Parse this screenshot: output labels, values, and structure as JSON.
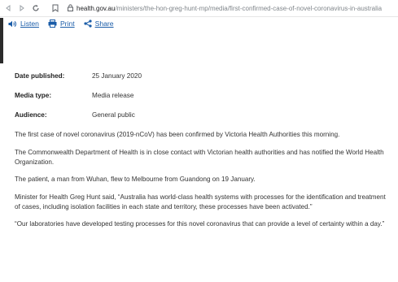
{
  "browser": {
    "url_domain": "health.gov.au",
    "url_path": "/ministers/the-hon-greg-hunt-mp/media/first-confirmed-case-of-novel-coronavirus-in-australia"
  },
  "tools": {
    "listen": "Listen",
    "print": "Print",
    "share": "Share"
  },
  "meta": {
    "date_key": "Date published:",
    "date_value": "25 January 2020",
    "type_key": "Media type:",
    "type_value": "Media release",
    "audience_key": "Audience:",
    "audience_value": "General public"
  },
  "article": {
    "p1": "The first case of novel coronavirus (2019-nCoV) has been confirmed by Victoria Health Authorities this morning.",
    "p2": "The Commonwealth Department of Health is in close contact with Victorian health authorities and has notified the World Health Organization.",
    "p3": "The patient, a man from Wuhan, flew to Melbourne from Guandong on 19 January.",
    "p4": "Minister for Health Greg Hunt said, “Australia has world-class health systems with processes for the identification and treatment of cases, including isolation facilities in each state and territory, these processes have been activated.”",
    "p5": "“Our laboratories have developed testing processes for this novel coronavirus that can provide a level of certainty within a day.”"
  },
  "colors": {
    "link": "#1a5ca8",
    "text": "#333333"
  }
}
